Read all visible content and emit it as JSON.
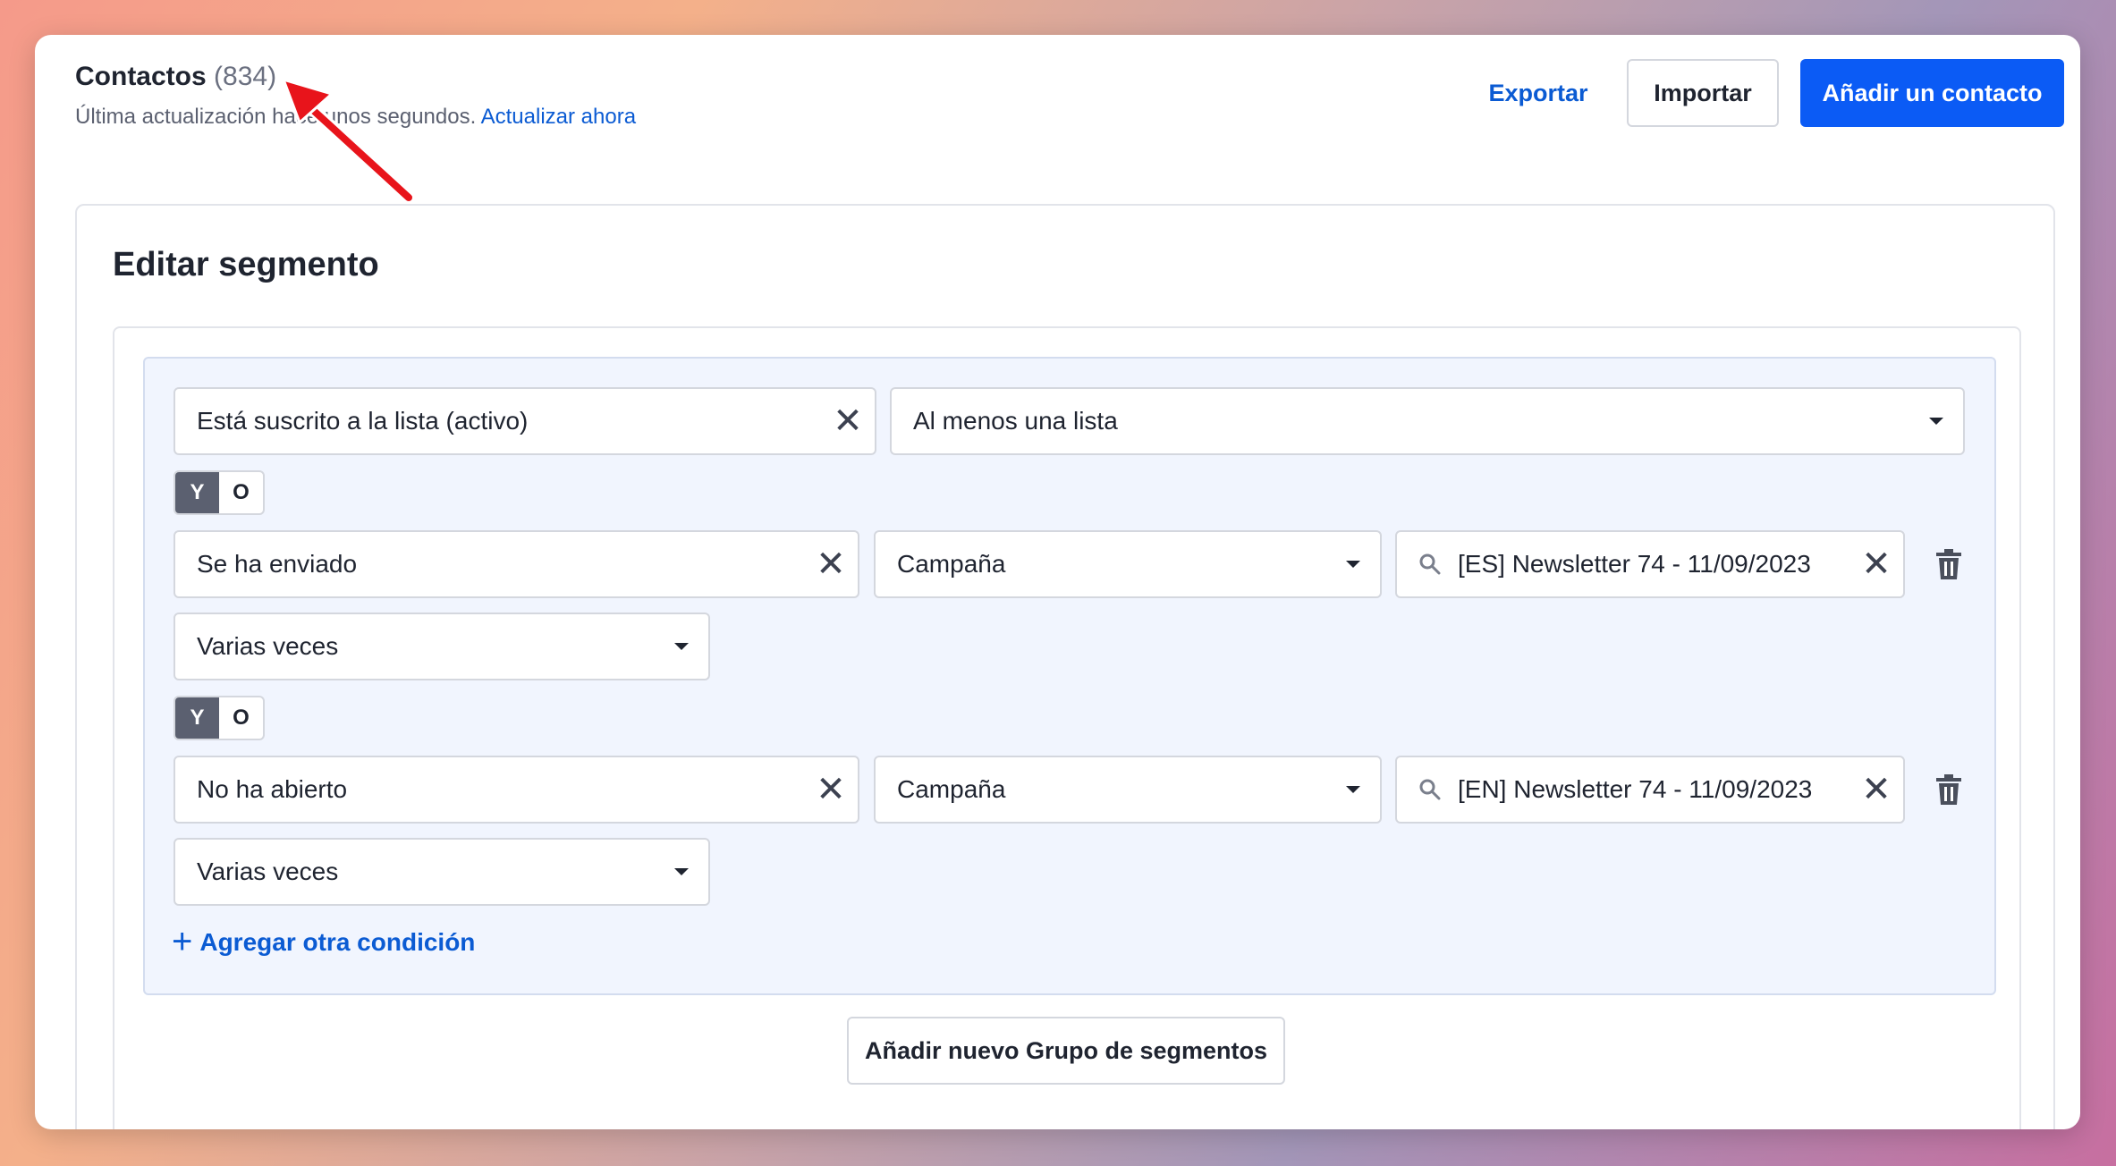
{
  "header": {
    "title": "Contactos",
    "count": "(834)",
    "subtitle": "Última actualización hace unos segundos.",
    "refresh_link": "Actualizar ahora"
  },
  "actions": {
    "export_label": "Exportar",
    "import_label": "Importar",
    "add_contact_label": "Añadir un contacto"
  },
  "segment": {
    "title": "Editar segmento",
    "rows": [
      {
        "condition": "Está suscrito a la lista (activo)",
        "option": "Al menos una lista"
      },
      {
        "condition": "Se ha enviado",
        "type": "Campaña",
        "campaign": "[ES] Newsletter 74 - 11/09/2023",
        "frequency": "Varias veces"
      },
      {
        "condition": "No ha abierto",
        "type": "Campaña",
        "campaign": "[EN] Newsletter 74 - 11/09/2023",
        "frequency": "Varias veces"
      }
    ],
    "toggle": {
      "and_label": "Y",
      "or_label": "O"
    },
    "add_condition_label": "Agregar otra condición",
    "add_group_label": "Añadir nuevo Grupo de segmentos"
  },
  "colors": {
    "accent": "#0b5bf5",
    "link": "#0b5bd3",
    "annotation_arrow": "#e8141b"
  }
}
